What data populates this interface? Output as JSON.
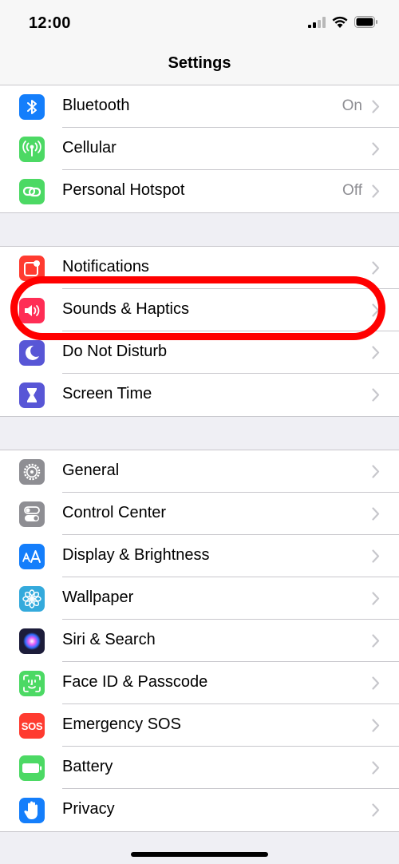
{
  "status_bar": {
    "time": "12:00"
  },
  "nav": {
    "title": "Settings"
  },
  "groups": [
    [
      {
        "label": "Bluetooth",
        "value": "On",
        "icon": "bluetooth-icon",
        "color": "#147efb"
      },
      {
        "label": "Cellular",
        "value": "",
        "icon": "cellular-antenna-icon",
        "color": "#4cd964"
      },
      {
        "label": "Personal Hotspot",
        "value": "Off",
        "icon": "hotspot-link-icon",
        "color": "#4cd964"
      }
    ],
    [
      {
        "label": "Notifications",
        "value": "",
        "icon": "notifications-icon",
        "color": "#ff3b30"
      },
      {
        "label": "Sounds & Haptics",
        "value": "",
        "icon": "speaker-icon",
        "color": "#ff2d55"
      },
      {
        "label": "Do Not Disturb",
        "value": "",
        "icon": "moon-icon",
        "color": "#5856d6"
      },
      {
        "label": "Screen Time",
        "value": "",
        "icon": "hourglass-icon",
        "color": "#5856d6"
      }
    ],
    [
      {
        "label": "General",
        "value": "",
        "icon": "gear-icon",
        "color": "#8e8e93"
      },
      {
        "label": "Control Center",
        "value": "",
        "icon": "toggles-icon",
        "color": "#8e8e93"
      },
      {
        "label": "Display & Brightness",
        "value": "",
        "icon": "text-size-icon",
        "color": "#147efb"
      },
      {
        "label": "Wallpaper",
        "value": "",
        "icon": "flower-icon",
        "color": "#34aadc"
      },
      {
        "label": "Siri & Search",
        "value": "",
        "icon": "siri-icon",
        "color": "#1c1c3a"
      },
      {
        "label": "Face ID & Passcode",
        "value": "",
        "icon": "face-id-icon",
        "color": "#4cd964"
      },
      {
        "label": "Emergency SOS",
        "value": "",
        "icon": "sos-icon",
        "color": "#ff3b30",
        "icon_text": "SOS"
      },
      {
        "label": "Battery",
        "value": "",
        "icon": "battery-icon",
        "color": "#4cd964"
      },
      {
        "label": "Privacy",
        "value": "",
        "icon": "hand-icon",
        "color": "#147efb"
      }
    ]
  ],
  "annotation": {
    "highlight_color": "#ff0000"
  }
}
